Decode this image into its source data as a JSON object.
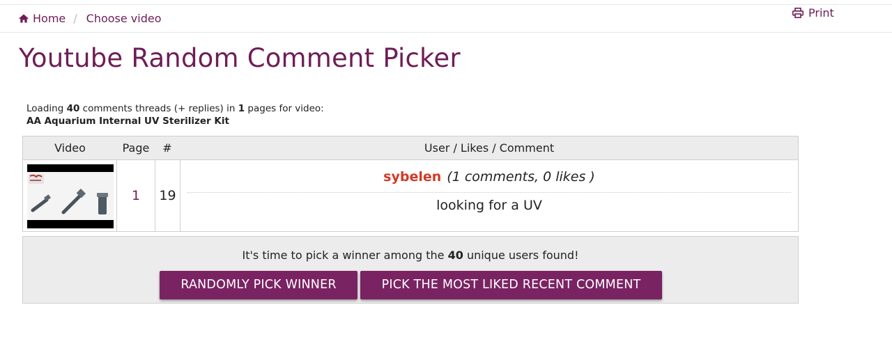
{
  "breadcrumb": {
    "home": "Home",
    "current": "Choose video"
  },
  "toolbar": {
    "print": "Print"
  },
  "page": {
    "title": "Youtube Random Comment Picker"
  },
  "loading": {
    "prefix": "Loading",
    "threads_count": "40",
    "middle": "comments threads (+ replies) in",
    "pages_count": "1",
    "suffix": "pages for video:",
    "video_title": "AA Aquarium Internal UV Sterilizer Kit"
  },
  "table": {
    "headers": [
      "Video",
      "Page",
      "#",
      "User / Likes / Comment"
    ],
    "row": {
      "page": "1",
      "index": "19",
      "user": "sybelen",
      "stats": "(1 comments, 0 likes )",
      "comment": "looking for a UV"
    }
  },
  "pick": {
    "text_prefix": "It's time to pick a winner among the",
    "count": "40",
    "text_suffix": "unique users found!",
    "random_button": "RANDOMLY PICK WINNER",
    "liked_button": "PICK THE MOST LIKED RECENT COMMENT"
  },
  "colors": {
    "accent": "#6f1d56",
    "button": "#7a2363",
    "username": "#d13b24",
    "panel": "#ececec"
  },
  "icons": {
    "home": "home-icon",
    "print": "print-icon"
  }
}
